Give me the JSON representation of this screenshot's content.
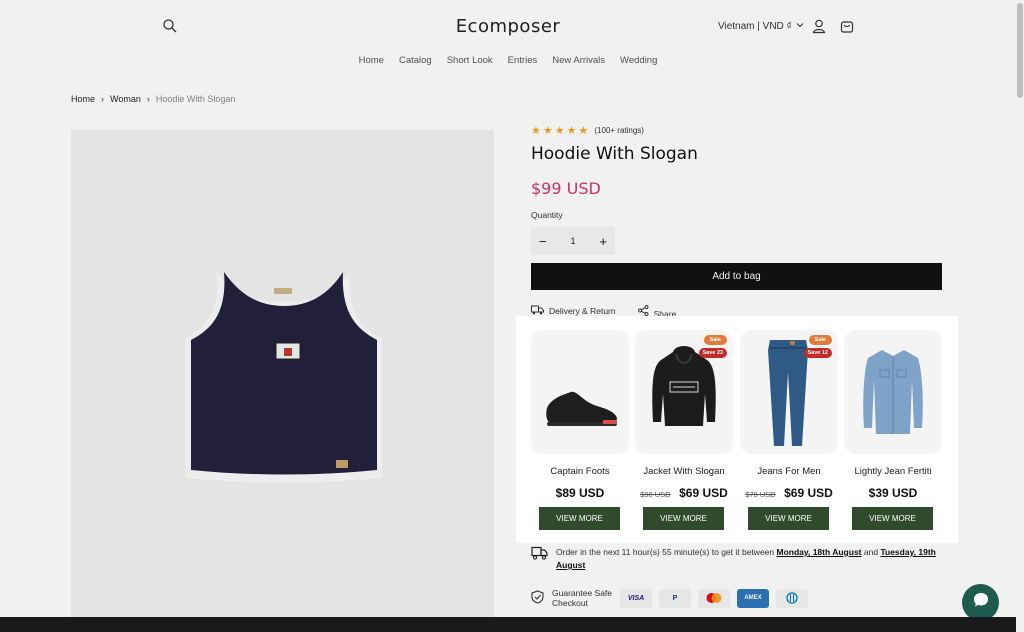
{
  "header": {
    "logo": "Ecomposer",
    "currency": "Vietnam | VND ₫",
    "nav": [
      "Home",
      "Catalog",
      "Short Look",
      "Entries",
      "New Arrivals",
      "Wedding"
    ]
  },
  "breadcrumb": [
    "Home",
    "Woman",
    "Hoodie With Slogan"
  ],
  "product": {
    "rating_text": "(100+ ratings)",
    "stars": 5,
    "title": "Hoodie With Slogan",
    "price": "$99 USD",
    "quantity_label": "Quantity",
    "quantity": "1",
    "add_to_bag": "Add to bag",
    "delivery": "Delivery & Return",
    "share": "Share"
  },
  "recommendations": [
    {
      "name": "Captain Foots",
      "price": "$89 USD",
      "button": "VIEW MORE"
    },
    {
      "name": "Jacket With Slogan",
      "old_price": "$90 USD",
      "price": "$69 USD",
      "sale": "Sale",
      "save": "Save 23",
      "button": "VIEW MORE"
    },
    {
      "name": "Jeans For Men",
      "old_price": "$78 USD",
      "price": "$69 USD",
      "sale": "Sale",
      "save": "Save 12",
      "button": "VIEW MORE"
    },
    {
      "name": "Lightly Jean Fertiti",
      "price": "$39 USD",
      "button": "VIEW MORE"
    }
  ],
  "order": {
    "text1": "Order in the next 11 hour(s) 55 minute(s) to get it between",
    "date1": "Monday, 18th August",
    "and": "and",
    "date2": "Tuesday, 19th August"
  },
  "guarantee": {
    "text": "Guarantee Safe Checkout",
    "payments": [
      "VISA",
      "P",
      "MC",
      "AMEX",
      "D"
    ]
  },
  "colors": {
    "accent_price": "#d6336c",
    "button_dark": "#111111",
    "view_more": "#2f4b2b",
    "sale_badge": "#e07b3a",
    "save_badge": "#c42a2a",
    "chat": "#1e5a4e"
  }
}
